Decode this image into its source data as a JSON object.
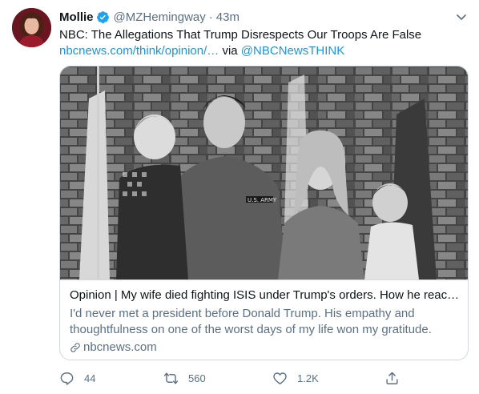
{
  "author": {
    "name": "Mollie",
    "handle": "@MZHemingway",
    "separator": "·",
    "time": "43m"
  },
  "tweet": {
    "text": "NBC: The Allegations That Trump Disrespects Our Troops Are False",
    "link_text": "nbcnews.com/think/opinion/…",
    "via": " via ",
    "via_handle": "@NBCNewsTHINK"
  },
  "card": {
    "title": "Opinion | My wife died fighting ISIS under Trump's orders. How he react…",
    "description": "I'd never met a president before Donald Trump. His empathy and thoughtfulness on one of the worst days of my life won my gratitude.",
    "domain": "nbcnews.com",
    "photo_text": "U.S. ARMY"
  },
  "actions": {
    "reply": {
      "icon": "reply-icon",
      "count": "44"
    },
    "retweet": {
      "icon": "retweet-icon",
      "count": "560"
    },
    "like": {
      "icon": "heart-icon",
      "count": "1.2K"
    },
    "share": {
      "icon": "share-icon"
    }
  },
  "colors": {
    "link": "#1b95e0",
    "secondary_text": "#5b7083",
    "verified": "#1da1f2",
    "border": "#cfd9de"
  }
}
